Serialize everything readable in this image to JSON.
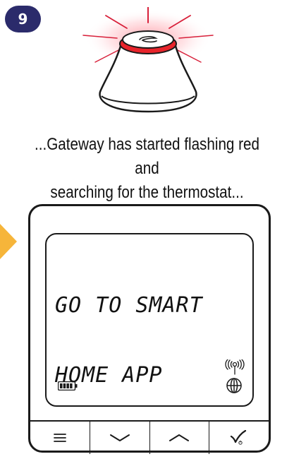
{
  "step": {
    "number": "9"
  },
  "caption": {
    "line1": "...Gateway has started flashing red and",
    "line2": "searching for the thermostat..."
  },
  "gateway": {
    "status_light_color": "#e8242b",
    "glow_color": "#e0283a",
    "logo_icon": "s-logo-icon"
  },
  "thermostat": {
    "display_line1": "GO TO SMART",
    "display_line2": "HOME APP",
    "battery_icon": "battery-full-icon",
    "signal_icon": "wireless-signal-icon",
    "globe_icon": "globe-icon",
    "buttons": [
      {
        "icon": "menu-icon"
      },
      {
        "icon": "chevron-down-icon"
      },
      {
        "icon": "chevron-up-icon"
      },
      {
        "icon": "checkmark-power-icon"
      }
    ]
  },
  "colors": {
    "badge": "#2b2b6b",
    "arrow": "#f6b53a",
    "outline": "#1a1a1a"
  }
}
